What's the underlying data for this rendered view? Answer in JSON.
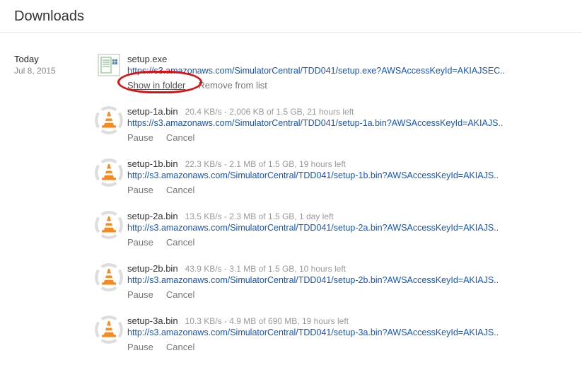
{
  "header": {
    "title": "Downloads"
  },
  "date": {
    "label": "Today",
    "value": "Jul 8, 2015"
  },
  "downloads": [
    {
      "icon": "file",
      "filename": "setup.exe",
      "stats": "",
      "url": "https://s3.amazonaws.com/SimulatorCentral/TDD041/setup.exe?AWSAccessKeyId=AKIAJSEC..",
      "action1": "Show in folder",
      "action2": "Remove from list",
      "highlight_action1": true
    },
    {
      "icon": "vlc",
      "filename": "setup-1a.bin",
      "stats": "20.4 KB/s - 2,006 KB of 1.5 GB, 21 hours left",
      "url": "https://s3.amazonaws.com/SimulatorCentral/TDD041/setup-1a.bin?AWSAccessKeyId=AKIAJS..",
      "action1": "Pause",
      "action2": "Cancel"
    },
    {
      "icon": "vlc",
      "filename": "setup-1b.bin",
      "stats": "22.3 KB/s - 2.1 MB of 1.5 GB, 19 hours left",
      "url": "http://s3.amazonaws.com/SimulatorCentral/TDD041/setup-1b.bin?AWSAccessKeyId=AKIAJS..",
      "action1": "Pause",
      "action2": "Cancel"
    },
    {
      "icon": "vlc",
      "filename": "setup-2a.bin",
      "stats": "13.5 KB/s - 2.3 MB of 1.5 GB, 1 day left",
      "url": "http://s3.amazonaws.com/SimulatorCentral/TDD041/setup-2a.bin?AWSAccessKeyId=AKIAJS..",
      "action1": "Pause",
      "action2": "Cancel"
    },
    {
      "icon": "vlc",
      "filename": "setup-2b.bin",
      "stats": "43.9 KB/s - 3.1 MB of 1.5 GB, 10 hours left",
      "url": "http://s3.amazonaws.com/SimulatorCentral/TDD041/setup-2b.bin?AWSAccessKeyId=AKIAJS..",
      "action1": "Pause",
      "action2": "Cancel"
    },
    {
      "icon": "vlc",
      "filename": "setup-3a.bin",
      "stats": "10.3 KB/s - 4.9 MB of 690 MB, 19 hours left",
      "url": "http://s3.amazonaws.com/SimulatorCentral/TDD041/setup-3a.bin?AWSAccessKeyId=AKIAJS..",
      "action1": "Pause",
      "action2": "Cancel"
    }
  ]
}
